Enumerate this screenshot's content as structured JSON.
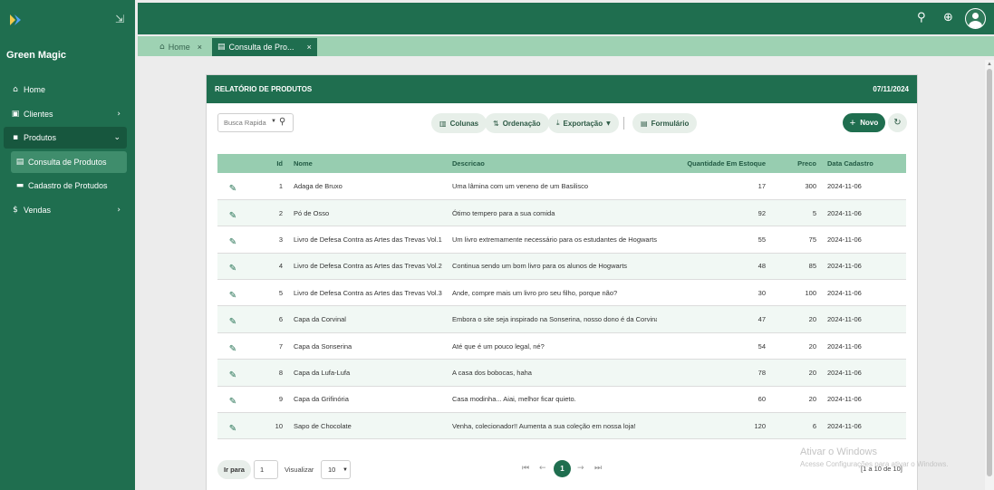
{
  "app": {
    "brand": "Green Magic"
  },
  "sidebar": {
    "items": [
      {
        "label": "Home",
        "icon": "home-icon"
      },
      {
        "label": "Clientes",
        "icon": "address-card-icon"
      },
      {
        "label": "Produtos",
        "icon": "box-icon"
      },
      {
        "label": "Consulta de Produtos",
        "icon": "book-icon"
      },
      {
        "label": "Cadastro de Protudos",
        "icon": "archive-icon"
      },
      {
        "label": "Vendas",
        "icon": "dollar-icon"
      }
    ]
  },
  "tabs": [
    {
      "label": "Home",
      "icon": "home-icon",
      "close": "×"
    },
    {
      "label": "Consulta de Pro...",
      "icon": "book-icon",
      "close": "×"
    }
  ],
  "report": {
    "title": "RELATÓRIO DE PRODUTOS",
    "date": "07/11/2024",
    "search_placeholder": "Busca Rapida",
    "toolbar": {
      "colunas": "Colunas",
      "ordenacao": "Ordenação",
      "exportacao": "Exportação",
      "formulario": "Formulário",
      "novo": "Novo"
    },
    "columns": [
      "Id",
      "Nome",
      "Descricao",
      "Quantidade Em Estoque",
      "Preco",
      "Data Cadastro"
    ],
    "rows": [
      {
        "id": "1",
        "nome": "Adaga de Bruxo",
        "descricao": "Uma lâmina com um veneno de um Basilisco",
        "qtd": "17",
        "preco": "300",
        "data": "2024-11-06"
      },
      {
        "id": "2",
        "nome": "Pó de Osso",
        "descricao": "Ótimo tempero para a sua comida",
        "qtd": "92",
        "preco": "5",
        "data": "2024-11-06"
      },
      {
        "id": "3",
        "nome": "Livro de Defesa Contra as Artes das Trevas Vol.1",
        "descricao": "Um livro extremamente necessário para os estudantes de Hogwarts",
        "qtd": "55",
        "preco": "75",
        "data": "2024-11-06"
      },
      {
        "id": "4",
        "nome": "Livro de Defesa Contra as Artes das Trevas Vol.2",
        "descricao": "Continua sendo um bom livro para os alunos de Hogwarts",
        "qtd": "48",
        "preco": "85",
        "data": "2024-11-06"
      },
      {
        "id": "5",
        "nome": "Livro de Defesa Contra as Artes das Trevas Vol.3",
        "descricao": "Ande, compre mais um livro pro seu filho, porque não?",
        "qtd": "30",
        "preco": "100",
        "data": "2024-11-06"
      },
      {
        "id": "6",
        "nome": "Capa da Corvinal",
        "descricao": "Embora o site seja inspirado na Sonserina, nosso dono é da Corvinal...",
        "qtd": "47",
        "preco": "20",
        "data": "2024-11-06"
      },
      {
        "id": "7",
        "nome": "Capa da Sonserina",
        "descricao": "Até que é um pouco legal, né?",
        "qtd": "54",
        "preco": "20",
        "data": "2024-11-06"
      },
      {
        "id": "8",
        "nome": "Capa da Lufa-Lufa",
        "descricao": "A casa dos bobocas, haha",
        "qtd": "78",
        "preco": "20",
        "data": "2024-11-06"
      },
      {
        "id": "9",
        "nome": "Capa da Grifinória",
        "descricao": "Casa modinha... Aiai, melhor ficar quieto.",
        "qtd": "60",
        "preco": "20",
        "data": "2024-11-06"
      },
      {
        "id": "10",
        "nome": "Sapo de Chocolate",
        "descricao": "Venha, colecionador!! Aumenta a sua coleção em nossa loja!",
        "qtd": "120",
        "preco": "6",
        "data": "2024-11-06"
      }
    ],
    "footer": {
      "ir_para": "Ir para",
      "page_input": "1",
      "visualizar": "Visualizar",
      "page_size": "10",
      "current_page": "1",
      "range": "[1 a 10 de 10]"
    }
  },
  "watermark": {
    "line1": "Ativar o Windows",
    "line2": "Acesse Configurações para ativar o Windows."
  },
  "colors": {
    "primary": "#1f6e4f",
    "header_row": "#97cdb0",
    "tab_bar": "#9ed2b3"
  }
}
